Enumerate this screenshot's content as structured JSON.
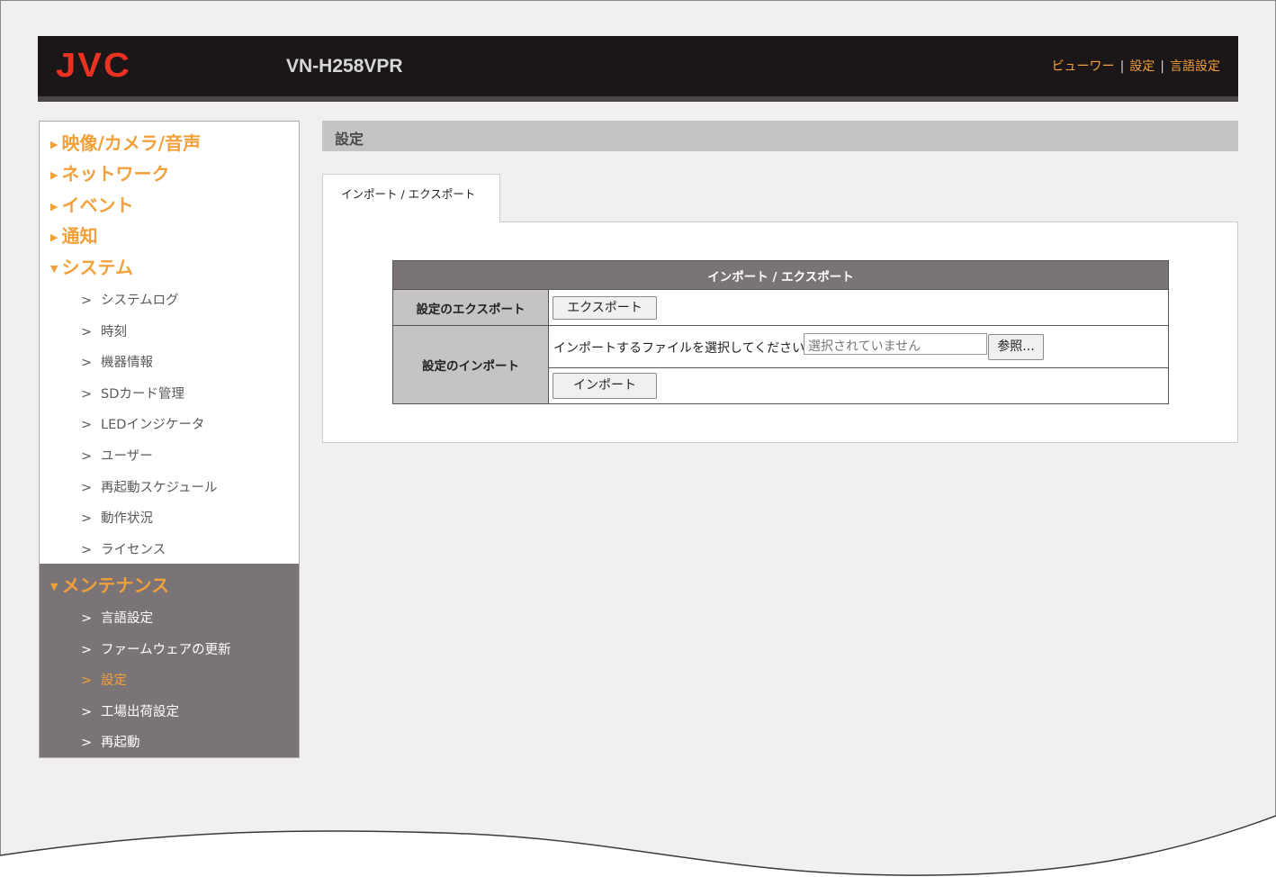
{
  "header": {
    "logo": "JVC",
    "model": "VN-H258VPR",
    "nav": [
      "ビューワー",
      "設定",
      "言語設定"
    ],
    "nav_sep": "|"
  },
  "colors": {
    "accent": "#f2a03a",
    "logo": "#ea3223",
    "header_bg": "#1b1718",
    "menu_dark": "#7b7476",
    "label_bg": "#c6c4c2"
  },
  "sidebar": {
    "arrow_right": "▶",
    "arrow_down": "▼",
    "sub_marker": ">",
    "categories": [
      "映像/カメラ/音声",
      "ネットワーク",
      "イベント",
      "通知",
      "システム"
    ],
    "system_items": [
      "システムログ",
      "時刻",
      "機器情報",
      "SDカード管理",
      "LEDインジケータ",
      "ユーザー",
      "再起動スケジュール",
      "動作状況",
      "ライセンス"
    ],
    "maintenance": {
      "label": "メンテナンス",
      "items": [
        "言語設定",
        "ファームウェアの更新",
        "設定",
        "工場出荷設定",
        "再起動"
      ],
      "active": "設定"
    }
  },
  "main": {
    "title": "設定",
    "tab_label": "インポート / エクスポート",
    "table": {
      "header": "インポート / エクスポート",
      "export_label": "設定のエクスポート",
      "export_button": "エクスポート",
      "import_label": "設定のインポート",
      "import_prompt": "インポートするファイルを選択してください",
      "file_placeholder": "選択されていません",
      "browse_button": "参照...",
      "import_button": "インポート"
    }
  }
}
